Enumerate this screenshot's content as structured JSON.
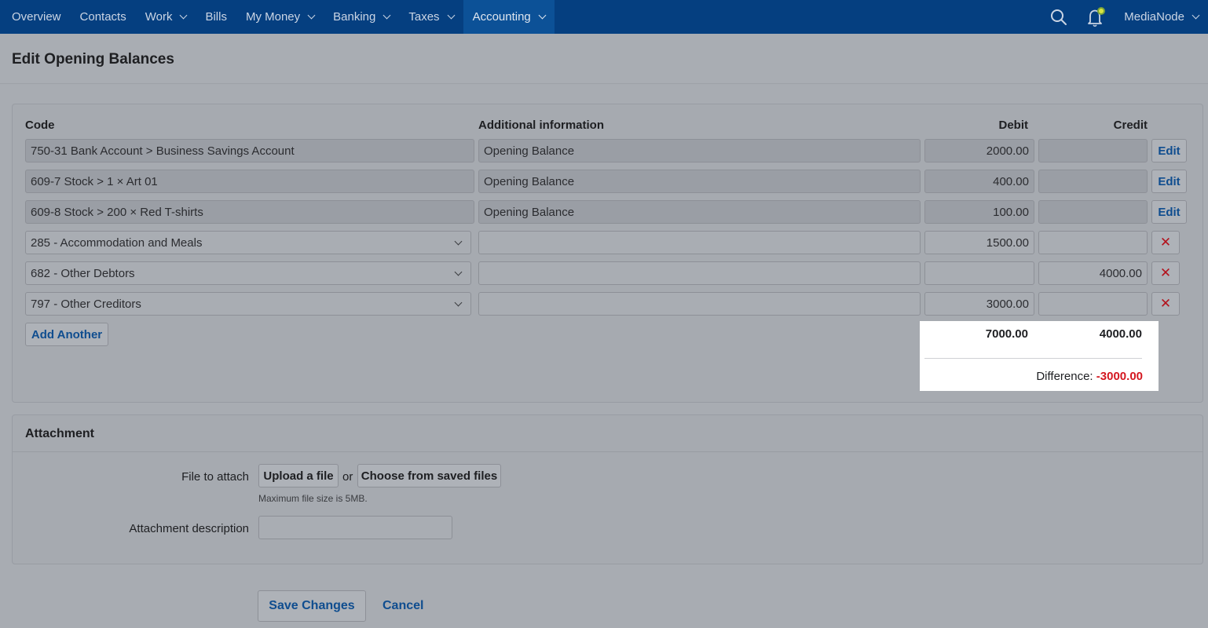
{
  "nav": {
    "items": [
      {
        "label": "Overview",
        "dropdown": false,
        "active": false
      },
      {
        "label": "Contacts",
        "dropdown": false,
        "active": false
      },
      {
        "label": "Work",
        "dropdown": true,
        "active": false
      },
      {
        "label": "Bills",
        "dropdown": false,
        "active": false
      },
      {
        "label": "My Money",
        "dropdown": true,
        "active": false
      },
      {
        "label": "Banking",
        "dropdown": true,
        "active": false
      },
      {
        "label": "Taxes",
        "dropdown": true,
        "active": false
      },
      {
        "label": "Accounting",
        "dropdown": true,
        "active": true
      }
    ],
    "account_name": "MediaNode",
    "icons": [
      "search-icon",
      "notification-bell-icon",
      "chevron-down-icon"
    ]
  },
  "page": {
    "title": "Edit Opening Balances"
  },
  "balances": {
    "headers": {
      "code": "Code",
      "info": "Additional information",
      "debit": "Debit",
      "credit": "Credit"
    },
    "rows": [
      {
        "code": "750-31 Bank Account  >  Business Savings Account",
        "info": "Opening Balance",
        "debit": "2000.00",
        "credit": "",
        "action": "Edit",
        "locked": true
      },
      {
        "code": "609-7 Stock  >  1 × Art 01",
        "info": "Opening Balance",
        "debit": "400.00",
        "credit": "",
        "action": "Edit",
        "locked": true
      },
      {
        "code": "609-8 Stock  >  200 × Red T-shirts",
        "info": "Opening Balance",
        "debit": "100.00",
        "credit": "",
        "action": "Edit",
        "locked": true
      },
      {
        "code": "285 - Accommodation and Meals",
        "info": "",
        "debit": "1500.00",
        "credit": "",
        "action": "✕",
        "locked": false
      },
      {
        "code": "682 - Other Debtors",
        "info": "",
        "debit": "",
        "credit": "4000.00",
        "action": "✕",
        "locked": false
      },
      {
        "code": "797 - Other Creditors",
        "info": "",
        "debit": "3000.00",
        "credit": "",
        "action": "✕",
        "locked": false
      }
    ],
    "add_label": "Add Another",
    "totals": {
      "debit": "7000.00",
      "credit": "4000.00",
      "difference_label": "Difference:",
      "difference_value": "-3000.00"
    }
  },
  "attachment": {
    "title": "Attachment",
    "file_label": "File to attach",
    "upload_label": "Upload a file",
    "or_text": "or",
    "choose_label": "Choose from saved files",
    "hint": "Maximum file size is 5MB.",
    "description_label": "Attachment description",
    "description_value": ""
  },
  "footer": {
    "save_label": "Save Changes",
    "cancel_label": "Cancel"
  },
  "colors": {
    "nav_bg": "#053f80",
    "nav_active": "#0c5197",
    "link": "#0f4d8f",
    "negative": "#d41821"
  }
}
